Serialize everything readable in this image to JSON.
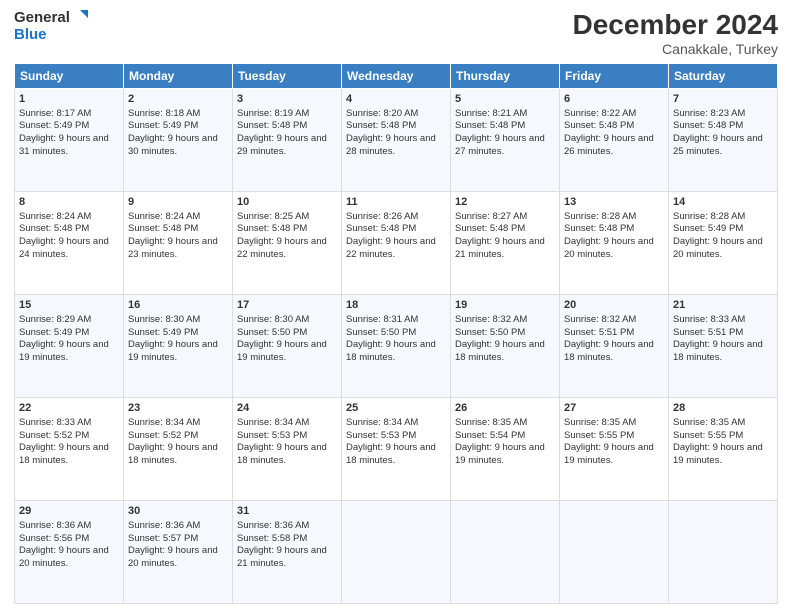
{
  "logo": {
    "line1": "General",
    "line2": "Blue"
  },
  "title": "December 2024",
  "subtitle": "Canakkale, Turkey",
  "headers": [
    "Sunday",
    "Monday",
    "Tuesday",
    "Wednesday",
    "Thursday",
    "Friday",
    "Saturday"
  ],
  "weeks": [
    [
      {
        "day": "1",
        "sunrise": "Sunrise: 8:17 AM",
        "sunset": "Sunset: 5:49 PM",
        "daylight": "Daylight: 9 hours and 31 minutes."
      },
      {
        "day": "2",
        "sunrise": "Sunrise: 8:18 AM",
        "sunset": "Sunset: 5:49 PM",
        "daylight": "Daylight: 9 hours and 30 minutes."
      },
      {
        "day": "3",
        "sunrise": "Sunrise: 8:19 AM",
        "sunset": "Sunset: 5:48 PM",
        "daylight": "Daylight: 9 hours and 29 minutes."
      },
      {
        "day": "4",
        "sunrise": "Sunrise: 8:20 AM",
        "sunset": "Sunset: 5:48 PM",
        "daylight": "Daylight: 9 hours and 28 minutes."
      },
      {
        "day": "5",
        "sunrise": "Sunrise: 8:21 AM",
        "sunset": "Sunset: 5:48 PM",
        "daylight": "Daylight: 9 hours and 27 minutes."
      },
      {
        "day": "6",
        "sunrise": "Sunrise: 8:22 AM",
        "sunset": "Sunset: 5:48 PM",
        "daylight": "Daylight: 9 hours and 26 minutes."
      },
      {
        "day": "7",
        "sunrise": "Sunrise: 8:23 AM",
        "sunset": "Sunset: 5:48 PM",
        "daylight": "Daylight: 9 hours and 25 minutes."
      }
    ],
    [
      {
        "day": "8",
        "sunrise": "Sunrise: 8:24 AM",
        "sunset": "Sunset: 5:48 PM",
        "daylight": "Daylight: 9 hours and 24 minutes."
      },
      {
        "day": "9",
        "sunrise": "Sunrise: 8:24 AM",
        "sunset": "Sunset: 5:48 PM",
        "daylight": "Daylight: 9 hours and 23 minutes."
      },
      {
        "day": "10",
        "sunrise": "Sunrise: 8:25 AM",
        "sunset": "Sunset: 5:48 PM",
        "daylight": "Daylight: 9 hours and 22 minutes."
      },
      {
        "day": "11",
        "sunrise": "Sunrise: 8:26 AM",
        "sunset": "Sunset: 5:48 PM",
        "daylight": "Daylight: 9 hours and 22 minutes."
      },
      {
        "day": "12",
        "sunrise": "Sunrise: 8:27 AM",
        "sunset": "Sunset: 5:48 PM",
        "daylight": "Daylight: 9 hours and 21 minutes."
      },
      {
        "day": "13",
        "sunrise": "Sunrise: 8:28 AM",
        "sunset": "Sunset: 5:48 PM",
        "daylight": "Daylight: 9 hours and 20 minutes."
      },
      {
        "day": "14",
        "sunrise": "Sunrise: 8:28 AM",
        "sunset": "Sunset: 5:49 PM",
        "daylight": "Daylight: 9 hours and 20 minutes."
      }
    ],
    [
      {
        "day": "15",
        "sunrise": "Sunrise: 8:29 AM",
        "sunset": "Sunset: 5:49 PM",
        "daylight": "Daylight: 9 hours and 19 minutes."
      },
      {
        "day": "16",
        "sunrise": "Sunrise: 8:30 AM",
        "sunset": "Sunset: 5:49 PM",
        "daylight": "Daylight: 9 hours and 19 minutes."
      },
      {
        "day": "17",
        "sunrise": "Sunrise: 8:30 AM",
        "sunset": "Sunset: 5:50 PM",
        "daylight": "Daylight: 9 hours and 19 minutes."
      },
      {
        "day": "18",
        "sunrise": "Sunrise: 8:31 AM",
        "sunset": "Sunset: 5:50 PM",
        "daylight": "Daylight: 9 hours and 18 minutes."
      },
      {
        "day": "19",
        "sunrise": "Sunrise: 8:32 AM",
        "sunset": "Sunset: 5:50 PM",
        "daylight": "Daylight: 9 hours and 18 minutes."
      },
      {
        "day": "20",
        "sunrise": "Sunrise: 8:32 AM",
        "sunset": "Sunset: 5:51 PM",
        "daylight": "Daylight: 9 hours and 18 minutes."
      },
      {
        "day": "21",
        "sunrise": "Sunrise: 8:33 AM",
        "sunset": "Sunset: 5:51 PM",
        "daylight": "Daylight: 9 hours and 18 minutes."
      }
    ],
    [
      {
        "day": "22",
        "sunrise": "Sunrise: 8:33 AM",
        "sunset": "Sunset: 5:52 PM",
        "daylight": "Daylight: 9 hours and 18 minutes."
      },
      {
        "day": "23",
        "sunrise": "Sunrise: 8:34 AM",
        "sunset": "Sunset: 5:52 PM",
        "daylight": "Daylight: 9 hours and 18 minutes."
      },
      {
        "day": "24",
        "sunrise": "Sunrise: 8:34 AM",
        "sunset": "Sunset: 5:53 PM",
        "daylight": "Daylight: 9 hours and 18 minutes."
      },
      {
        "day": "25",
        "sunrise": "Sunrise: 8:34 AM",
        "sunset": "Sunset: 5:53 PM",
        "daylight": "Daylight: 9 hours and 18 minutes."
      },
      {
        "day": "26",
        "sunrise": "Sunrise: 8:35 AM",
        "sunset": "Sunset: 5:54 PM",
        "daylight": "Daylight: 9 hours and 19 minutes."
      },
      {
        "day": "27",
        "sunrise": "Sunrise: 8:35 AM",
        "sunset": "Sunset: 5:55 PM",
        "daylight": "Daylight: 9 hours and 19 minutes."
      },
      {
        "day": "28",
        "sunrise": "Sunrise: 8:35 AM",
        "sunset": "Sunset: 5:55 PM",
        "daylight": "Daylight: 9 hours and 19 minutes."
      }
    ],
    [
      {
        "day": "29",
        "sunrise": "Sunrise: 8:36 AM",
        "sunset": "Sunset: 5:56 PM",
        "daylight": "Daylight: 9 hours and 20 minutes."
      },
      {
        "day": "30",
        "sunrise": "Sunrise: 8:36 AM",
        "sunset": "Sunset: 5:57 PM",
        "daylight": "Daylight: 9 hours and 20 minutes."
      },
      {
        "day": "31",
        "sunrise": "Sunrise: 8:36 AM",
        "sunset": "Sunset: 5:58 PM",
        "daylight": "Daylight: 9 hours and 21 minutes."
      },
      null,
      null,
      null,
      null
    ]
  ]
}
